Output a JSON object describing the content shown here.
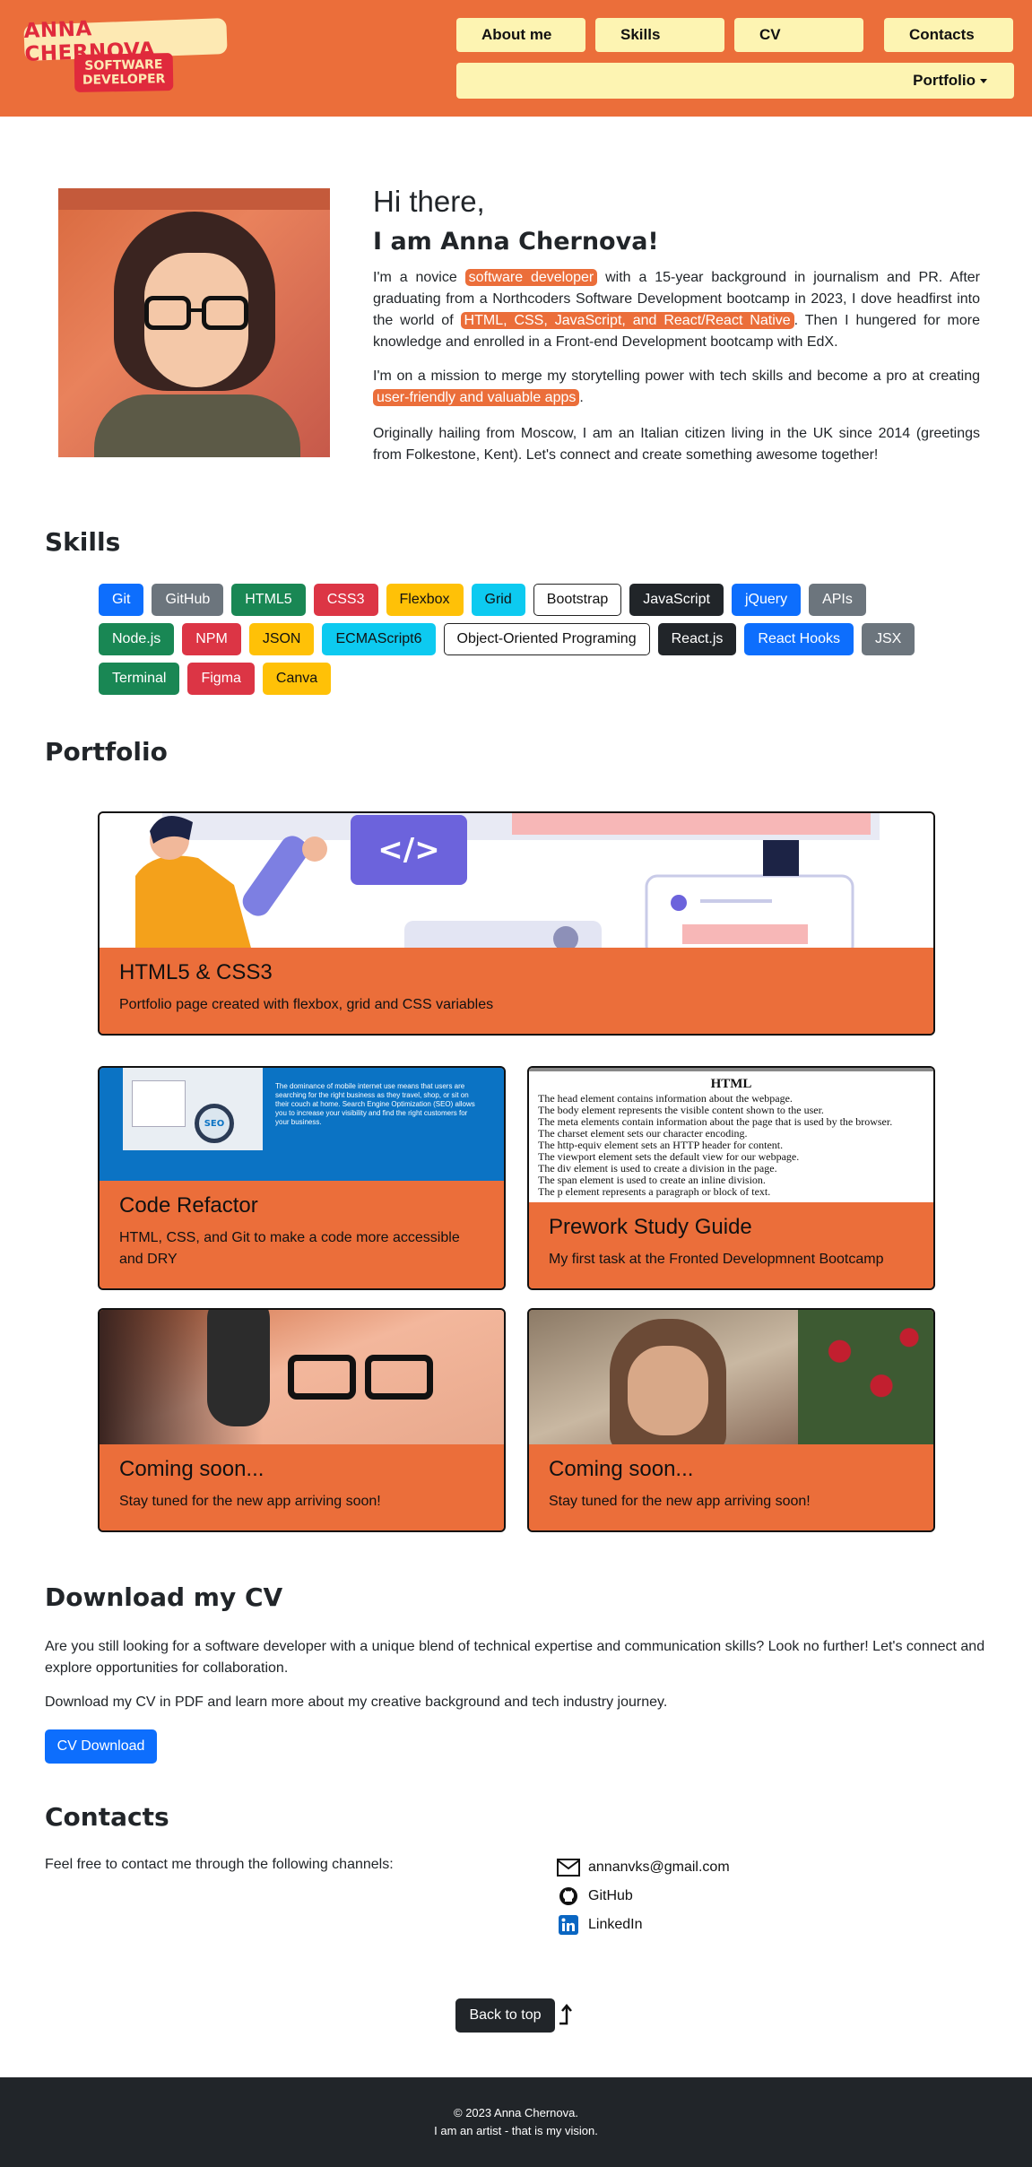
{
  "header": {
    "logo": {
      "name": "ANNA CHERNOVA",
      "line1": "SOFTWARE",
      "line2": "DEVELOPER"
    },
    "nav": [
      {
        "label": "About me"
      },
      {
        "label": "Skills"
      },
      {
        "label": "CV"
      },
      {
        "label": "Contacts"
      }
    ],
    "portfolio_label": "Portfolio"
  },
  "about": {
    "greeting": "Hi there,",
    "name_line": "I am Anna Chernova!",
    "p1_a": "I'm a novice ",
    "p1_hl1": "software developer",
    "p1_b": " with a 15-year background in journalism and PR. After graduating from a Northcoders Software Development bootcamp in 2023, I dove headfirst into the world of ",
    "p1_hl2": "HTML, CSS, JavaScript, and React/React Native",
    "p1_c": ". Then I hungered for more knowledge and enrolled in a Front-end Development bootcamp with EdX.",
    "p2_a": "I'm on a mission to merge my storytelling power with tech skills and become a pro at creating ",
    "p2_hl": "user-friendly and valuable apps",
    "p2_b": ".",
    "p3": "Originally hailing from Moscow, I am an Italian citizen living in the UK since 2014 (greetings from Folkestone, Kent). Let's connect and create something awesome together!"
  },
  "skills": {
    "heading": "Skills",
    "items": [
      {
        "label": "Git",
        "style": "blue"
      },
      {
        "label": "GitHub",
        "style": "gray"
      },
      {
        "label": "HTML5",
        "style": "green"
      },
      {
        "label": "CSS3",
        "style": "red"
      },
      {
        "label": "Flexbox",
        "style": "yellow"
      },
      {
        "label": "Grid",
        "style": "cyan"
      },
      {
        "label": "Bootstrap",
        "style": "light"
      },
      {
        "label": "JavaScript",
        "style": "dark"
      },
      {
        "label": "jQuery",
        "style": "blue"
      },
      {
        "label": "APIs",
        "style": "gray"
      },
      {
        "label": "Node.js",
        "style": "green"
      },
      {
        "label": "NPM",
        "style": "red"
      },
      {
        "label": "JSON",
        "style": "yellow"
      },
      {
        "label": "ECMAScript6",
        "style": "cyan"
      },
      {
        "label": "Object-Oriented Programing",
        "style": "light"
      },
      {
        "label": "React.js",
        "style": "dark"
      },
      {
        "label": "React Hooks",
        "style": "blue"
      },
      {
        "label": "JSX",
        "style": "gray"
      },
      {
        "label": "Terminal",
        "style": "green"
      },
      {
        "label": "Figma",
        "style": "red"
      },
      {
        "label": "Canva",
        "style": "yellow"
      }
    ]
  },
  "portfolio": {
    "heading": "Portfolio",
    "cards": [
      {
        "title": "HTML5 & CSS3",
        "text": "Portfolio page created with flexbox, grid and CSS variables"
      },
      {
        "title": "Code Refactor",
        "text": "HTML, CSS, and Git to make a code more accessible and DRY"
      },
      {
        "title": "Prework Study Guide",
        "text": "My first task at the Fronted Developmnent Bootcamp"
      },
      {
        "title": "Coming soon...",
        "text": "Stay tuned for the new app arriving soon!"
      },
      {
        "title": "Coming soon...",
        "text": "Stay tuned for the new app arriving soon!"
      }
    ],
    "seo_snippet": "The dominance of mobile internet use means that users are searching for the right business as they travel, shop, or sit on their couch at home. Search Engine Optimization (SEO) allows you to increase your visibility and find the right customers for your business.",
    "seo_badge": "SEO",
    "guide": {
      "heading": "HTML",
      "lines": [
        "The head element contains information about the webpage.",
        "The body element represents the visible content shown to the user.",
        "The meta elements contain information about the page that is used by the browser.",
        "The charset element sets our character encoding.",
        "The http-equiv element sets an HTTP header for content.",
        "The viewport element sets the default view for our webpage.",
        "The div element is used to create a division in the page.",
        "The span element is used to create an inline division.",
        "The p element represents a paragraph or block of text."
      ]
    }
  },
  "cv": {
    "heading": "Download my CV",
    "p1": "Are you still looking for a software developer with a unique blend of technical expertise and communication skills? Look no further! Let's connect and explore opportunities for collaboration.",
    "p2": "Download my CV in PDF and learn more about my creative background and tech industry journey.",
    "button": "CV Download"
  },
  "contacts": {
    "heading": "Contacts",
    "intro": "Feel free to contact me through the following channels:",
    "items": [
      {
        "label": "annanvks@gmail.com",
        "icon": "envelope-icon"
      },
      {
        "label": "GitHub",
        "icon": "github-icon"
      },
      {
        "label": "LinkedIn",
        "icon": "linkedin-icon"
      }
    ]
  },
  "back_to_top": "Back to top",
  "footer": {
    "line1": "© 2023 Anna Chernova.",
    "line2": "I am an artist - that is my vision."
  }
}
